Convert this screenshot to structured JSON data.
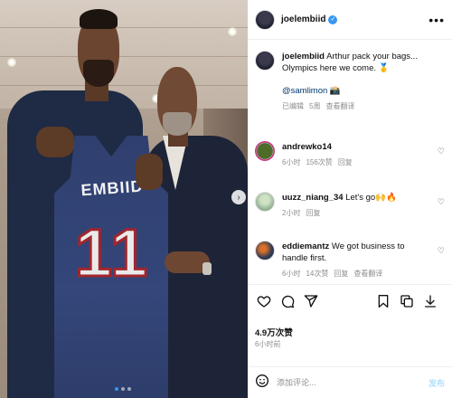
{
  "post": {
    "username": "joelembiid",
    "more_icon": "more-horizontal-icon",
    "photo": {
      "jersey_name": "EMBIID",
      "jersey_number": "11"
    }
  },
  "caption": {
    "username": "joelembiid",
    "text": "Arthur pack your bags... Olympics here we come. 🥇",
    "mention": "@samlimon 📸",
    "edited": "已编辑",
    "age": "5周",
    "translate": "查看翻译"
  },
  "comments": [
    {
      "username": "andrewko14",
      "text": "",
      "age": "6小时",
      "likes": "156次赞",
      "reply": "回复"
    },
    {
      "username": "uuzz_niang_34",
      "text": "Let's go🙌🔥",
      "age": "2小时",
      "likes": "",
      "reply": "回复"
    },
    {
      "username": "eddiemantz",
      "text": "We got business to handle first.",
      "age": "6小时",
      "likes": "14次赞",
      "reply": "回复",
      "translate": "查看翻译"
    }
  ],
  "engagement": {
    "likes": "4.9万次赞",
    "time": "6小时前"
  },
  "composer": {
    "placeholder": "添加评论...",
    "post_label": "发布"
  },
  "colors": {
    "verified": "#3897f0",
    "mention": "#00376b",
    "muted": "#8e8e8e"
  }
}
